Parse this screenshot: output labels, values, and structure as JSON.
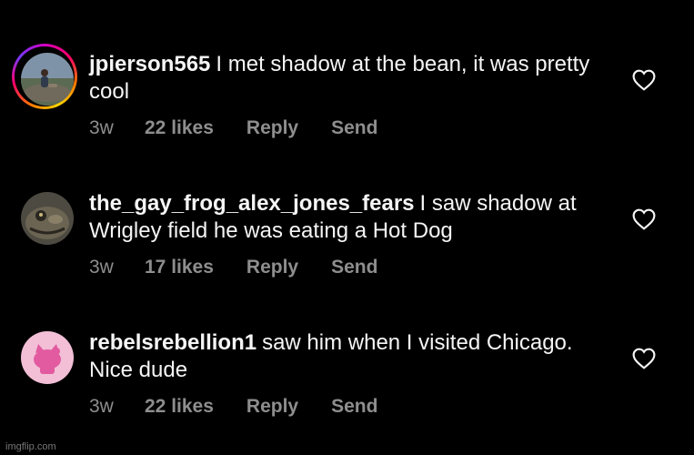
{
  "comments": [
    {
      "username": "jpierson565",
      "text": "I met shadow at the bean, it was pretty cool",
      "time": "3w",
      "likes": "22 likes",
      "reply": "Reply",
      "send": "Send",
      "avatar": "person-on-rock-avatar"
    },
    {
      "username": "the_gay_frog_alex_jones_fears",
      "text": "I saw shadow at Wrigley field he was eating a Hot Dog",
      "time": "3w",
      "likes": "17 likes",
      "reply": "Reply",
      "send": "Send",
      "avatar": "frog-avatar"
    },
    {
      "username": "rebelsrebellion1",
      "text": "saw him when I visited Chicago. Nice dude",
      "time": "3w",
      "likes": "22 likes",
      "reply": "Reply",
      "send": "Send",
      "avatar": "hello-kitty-avatar"
    }
  ],
  "watermark": "imgflip.com",
  "colors": {
    "background": "#000000",
    "text": "#f5f5f5",
    "meta": "#8e8e8e"
  },
  "icons": [
    "like-heart-icon"
  ]
}
